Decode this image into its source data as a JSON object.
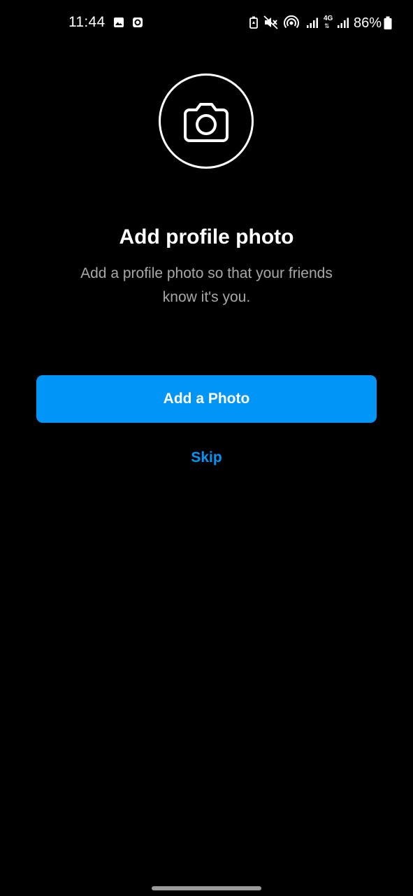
{
  "status_bar": {
    "time": "11:44",
    "battery_percent": "86%",
    "network_label": "4G",
    "icons": [
      "gallery-icon",
      "app-notification-icon",
      "battery-saver-icon",
      "mute-icon",
      "hotspot-icon",
      "signal-icon",
      "signal-icon",
      "battery-icon"
    ]
  },
  "main": {
    "icon": "camera-icon",
    "title": "Add profile photo",
    "subtitle": "Add a profile photo so that your friends know it's you."
  },
  "actions": {
    "primary_label": "Add a Photo",
    "secondary_label": "Skip"
  },
  "colors": {
    "background": "#000000",
    "accent": "#0095f6",
    "text_primary": "#ffffff",
    "text_secondary": "#a8a8a8"
  }
}
